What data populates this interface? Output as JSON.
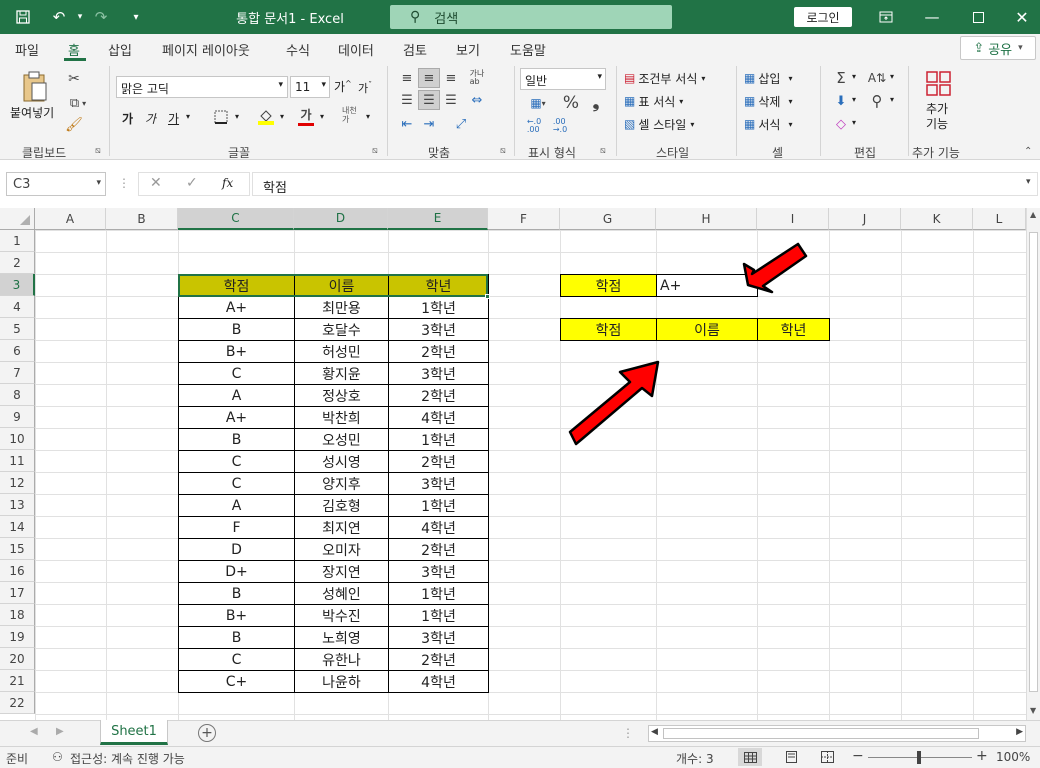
{
  "titlebar": {
    "title": "통합 문서1  -  Excel",
    "search": "검색",
    "login": "로그인"
  },
  "menu": {
    "tabs": [
      "파일",
      "홈",
      "삽입",
      "페이지 레이아웃",
      "수식",
      "데이터",
      "검토",
      "보기",
      "도움말"
    ],
    "active": "홈",
    "share": "공유"
  },
  "ribbon": {
    "paste": "붙여넣기",
    "clipboard_group": "클립보드",
    "font_name": "맑은 고딕",
    "font_size": "11",
    "font_group": "글꼴",
    "align_group": "맞춤",
    "number_format": "일반",
    "number_group": "표시 형식",
    "cond_format": "조건부 서식",
    "table_format": "표 서식",
    "cell_style": "셀 스타일",
    "style_group": "스타일",
    "insert": "삽입",
    "delete": "삭제",
    "format": "서식",
    "cells_group": "셀",
    "edit_group": "편집",
    "addins": "추가\n기능",
    "addins_group": "추가 기능"
  },
  "formula": {
    "namebox": "C3",
    "fx": "fx",
    "content": "학점"
  },
  "columns": [
    "A",
    "B",
    "C",
    "D",
    "E",
    "F",
    "G",
    "H",
    "I",
    "J",
    "K",
    "L"
  ],
  "rows": [
    "1",
    "2",
    "3",
    "4",
    "5",
    "6",
    "7",
    "8",
    "9",
    "10",
    "11",
    "12",
    "13",
    "14",
    "15",
    "16",
    "17",
    "18",
    "19",
    "20",
    "21",
    "22"
  ],
  "table": {
    "headers": [
      "학점",
      "이름",
      "학년"
    ],
    "rows": [
      [
        "A+",
        "최만용",
        "1학년"
      ],
      [
        "B",
        "호달수",
        "3학년"
      ],
      [
        "B+",
        "허성민",
        "2학년"
      ],
      [
        "C",
        "황지윤",
        "3학년"
      ],
      [
        "A",
        "정상호",
        "2학년"
      ],
      [
        "A+",
        "박찬희",
        "4학년"
      ],
      [
        "B",
        "오성민",
        "1학년"
      ],
      [
        "C",
        "성시영",
        "2학년"
      ],
      [
        "C",
        "양지후",
        "3학년"
      ],
      [
        "A",
        "김호형",
        "1학년"
      ],
      [
        "F",
        "최지연",
        "4학년"
      ],
      [
        "D",
        "오미자",
        "2학년"
      ],
      [
        "D+",
        "장지연",
        "3학년"
      ],
      [
        "B",
        "성혜인",
        "1학년"
      ],
      [
        "B+",
        "박수진",
        "1학년"
      ],
      [
        "B",
        "노희영",
        "3학년"
      ],
      [
        "C",
        "유한나",
        "2학년"
      ],
      [
        "C+",
        "나윤하",
        "4학년"
      ]
    ]
  },
  "criteria": {
    "label": "학점",
    "value": "A+"
  },
  "result_headers": [
    "학점",
    "이름",
    "학년"
  ],
  "sheet": {
    "tab": "Sheet1"
  },
  "status": {
    "ready": "준비",
    "access": "접근성: 계속 진행 가능",
    "count": "개수: 3",
    "zoom": "100%"
  },
  "colors": {
    "brand": "#217346",
    "header_yellow": "#ffff00",
    "header_olive": "#c9c400",
    "arrow_red": "#e00000"
  }
}
